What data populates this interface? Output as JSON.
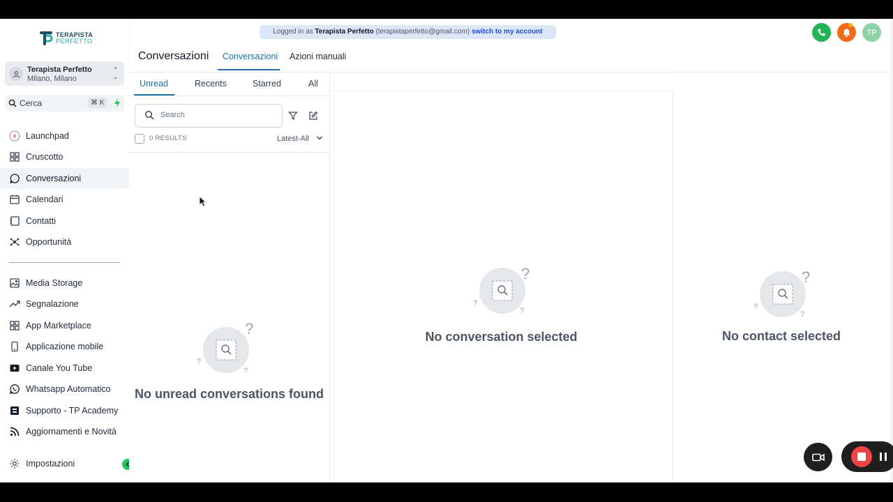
{
  "brand": {
    "line1": "TERAPISTA",
    "line2": "PERFETTO"
  },
  "account": {
    "name": "Terapista Perfetto",
    "location": "Milano, Milano"
  },
  "sidebar_search": {
    "label": "Cerca",
    "shortcut": "⌘ K"
  },
  "nav": [
    {
      "label": "Launchpad",
      "icon": "rocket-icon"
    },
    {
      "label": "Cruscotto",
      "icon": "dashboard-icon"
    },
    {
      "label": "Conversazioni",
      "icon": "chat-icon",
      "active": true
    },
    {
      "label": "Calendari",
      "icon": "calendar-icon"
    },
    {
      "label": "Contatti",
      "icon": "contacts-icon"
    },
    {
      "label": "Opportunità",
      "icon": "network-icon"
    }
  ],
  "nav2": [
    {
      "label": "Media Storage",
      "icon": "image-icon"
    },
    {
      "label": "Segnalazione",
      "icon": "trend-icon"
    },
    {
      "label": "App Marketplace",
      "icon": "grid-icon"
    },
    {
      "label": "Applicazione mobile",
      "icon": "phone-icon"
    },
    {
      "label": "Canale You Tube",
      "icon": "youtube-icon"
    },
    {
      "label": "Whatsapp Automatico",
      "icon": "whatsapp-icon"
    },
    {
      "label": "Supporto - TP Academy",
      "icon": "support-icon"
    },
    {
      "label": "Aggiornamenti e Novità",
      "icon": "rss-icon"
    }
  ],
  "settings_label": "Impostazioni",
  "impersonation": {
    "prefix": "Logged in as",
    "name": "Terapista Perfetto",
    "email": "(terapistaperfetto@gmail.com)",
    "switch": "switch to my account"
  },
  "header": {
    "title": "Conversazioni",
    "tabs": [
      "Conversazioni",
      "Azioni manuali"
    ],
    "avatar_initials": "TP"
  },
  "list": {
    "tabs": [
      "Unread",
      "Recents",
      "Starred",
      "All"
    ],
    "search_placeholder": "Search",
    "results": "0 RESULTS",
    "sort": "Latest-All",
    "empty": "No unread conversations found"
  },
  "conversation_panel": {
    "empty": "No conversation selected"
  },
  "contact_panel": {
    "empty": "No contact selected"
  },
  "colors": {
    "accent": "#1d6fa5",
    "call": "#22b355",
    "bell": "#f26b1d",
    "record": "#ef4444"
  }
}
